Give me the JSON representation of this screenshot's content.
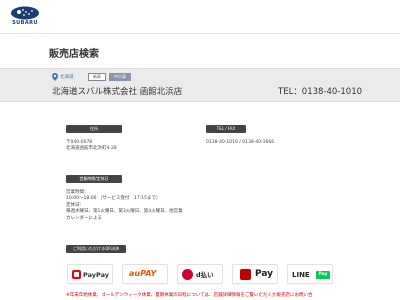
{
  "header": {
    "brand": "SUBARU",
    "brand_color": "#1a3d73"
  },
  "page": {
    "title": "販売店検索"
  },
  "shop": {
    "prefecture": "北海道",
    "tags": [
      "新車",
      "中古車"
    ],
    "name": "北海道スバル株式会社 函館北浜店",
    "tel": "TEL：0138-40-1010"
  },
  "info": {
    "address_label": "住所",
    "postal": "〒040-0078",
    "address": "北海道函館市北浜町4-28",
    "telfax_label": "TEL / FAX",
    "telfax": "0138-40-1010 / 0138-40-1666",
    "hours_label": "営業時間/定休日",
    "hours_lines": [
      "営業時間：",
      "10:00～18:00 （サービス受付　17:15まで）",
      "定休日：",
      "毎週水曜日、第1火曜日、第3火曜日、第4火曜日、他営業",
      "カレンダーによる"
    ],
    "qr_label": "ご利用いただけるQR決済"
  },
  "payments": [
    {
      "name": "PayPay",
      "icon": "paypay-icon"
    },
    {
      "name": "auPAY",
      "icon": "aupay-icon"
    },
    {
      "name": "d払い",
      "icon": "d-barai-icon"
    },
    {
      "name": "Pay",
      "icon": "rakuten-pay-icon"
    },
    {
      "name": "LINE",
      "badge": "Pay",
      "icon": "line-pay-icon"
    }
  ],
  "note": "※年末年始休業、ゴールデンウィーク休業、夏期休業の日程については、店舗詳細情報をご覧いただくか販売店にお問い合",
  "colors": {
    "accent_red": "#cc0000",
    "pill_bg": "#444444",
    "band_bg": "#ebebeb"
  }
}
